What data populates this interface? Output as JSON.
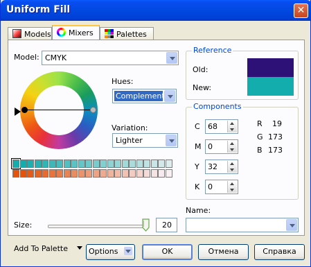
{
  "window": {
    "title": "Uniform Fill"
  },
  "icons": {
    "close": "close-icon",
    "models_tab": "models-icon",
    "mixers_tab": "color-wheel-icon",
    "palettes_tab": "palette-grid-icon"
  },
  "tabs": [
    {
      "label": "Models",
      "active": false
    },
    {
      "label": "Mixers",
      "active": true
    },
    {
      "label": "Palettes",
      "active": false
    }
  ],
  "model": {
    "label": "Model:",
    "value": "CMYK"
  },
  "hues": {
    "label": "Hues:",
    "value": "Complement"
  },
  "variation": {
    "label": "Variation:",
    "value": "Lighter"
  },
  "reference": {
    "title": "Reference",
    "old_label": "Old:",
    "new_label": "New:",
    "old_color": "#2e1177",
    "new_color": "#13adad"
  },
  "components": {
    "title": "Components",
    "cmyk": [
      {
        "label": "C",
        "value": "68"
      },
      {
        "label": "M",
        "value": "0"
      },
      {
        "label": "Y",
        "value": "32"
      },
      {
        "label": "K",
        "value": "0"
      }
    ],
    "rgb": [
      {
        "label": "R",
        "value": "19"
      },
      {
        "label": "G",
        "value": "173"
      },
      {
        "label": "B",
        "value": "173"
      }
    ]
  },
  "grid": {
    "row1": [
      "#13adad",
      "#13adad",
      "#1db0b0",
      "#27b3b3",
      "#31b6b6",
      "#3bb9b9",
      "#46bdbd",
      "#50c0c0",
      "#5ac3c3",
      "#64c6c6",
      "#6ec9c9",
      "#78cccc",
      "#83d0d0",
      "#8dd3d3",
      "#97d6d6",
      "#a1d9d9",
      "#abdcdc",
      "#b5dfdf",
      "#bfe3e3",
      "#c9e6e6",
      "#d3e9e9",
      "#ddecec"
    ],
    "row2": [
      "#e4530c",
      "#e4530c",
      "#e55b18",
      "#e66324",
      "#e76b30",
      "#e8733c",
      "#e97b48",
      "#ea8354",
      "#eb8b60",
      "#ec936c",
      "#ed9b78",
      "#eea384",
      "#efab90",
      "#f0b39c",
      "#f1bba8",
      "#f2c3b4",
      "#f3cbc0",
      "#f4d3cc",
      "#f5dbd8",
      "#f6e3e4",
      "#f7ebef",
      "#f8f0f3"
    ]
  },
  "size": {
    "label": "Size:",
    "value": "20",
    "level_fraction": 1.0
  },
  "name": {
    "label": "Name:",
    "value": ""
  },
  "buttons": {
    "add_to_palette": "Add To Palette",
    "options": "Options",
    "ok": "OK",
    "cancel": "Отмена",
    "help": "Справка"
  }
}
